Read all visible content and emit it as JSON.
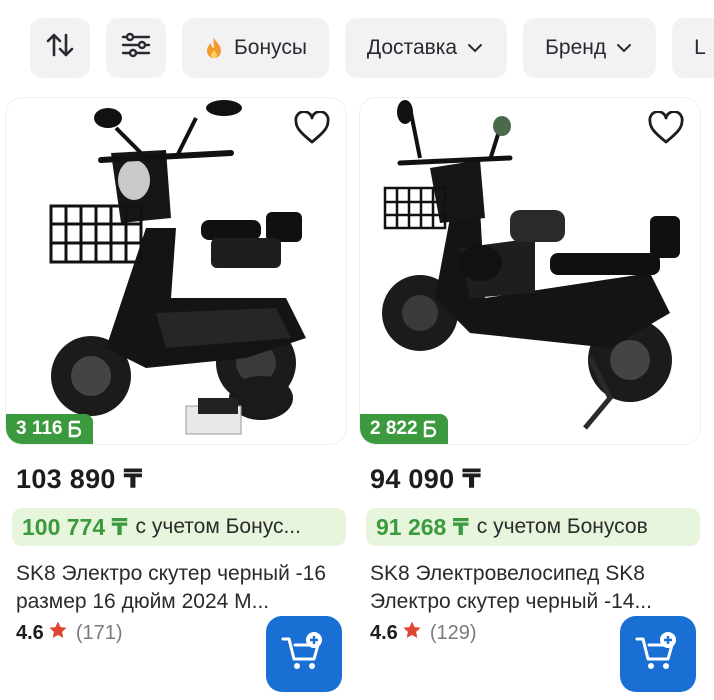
{
  "filters": {
    "sort_icon": "sort-arrows-icon",
    "settings_icon": "sliders-icon",
    "bonus_label": "Бонусы",
    "delivery_label": "Доставка",
    "brand_label": "Бренд",
    "partial_label": "L"
  },
  "products": [
    {
      "bonus_points": "3 116",
      "price": "103 890 ₸",
      "bonus_price": "100 774 ₸",
      "bonus_price_suffix": "с учетом Бонус...",
      "title": "SK8 Электро скутер черный -16 размер 16 дюйм 2024 М...",
      "rating": "4.6",
      "reviews": "(171)"
    },
    {
      "bonus_points": "2 822",
      "price": "94 090 ₸",
      "bonus_price": "91 268 ₸",
      "bonus_price_suffix": "с учетом Бонусов",
      "title": "SK8 Электровелосипед SK8 Электро скутер черный -14...",
      "rating": "4.6",
      "reviews": "(129)"
    }
  ],
  "colors": {
    "accent_green": "#3c9a3e",
    "bonus_bg": "#e6f5dc",
    "cart_blue": "#1a6fd4",
    "star_red": "#e0452f"
  }
}
